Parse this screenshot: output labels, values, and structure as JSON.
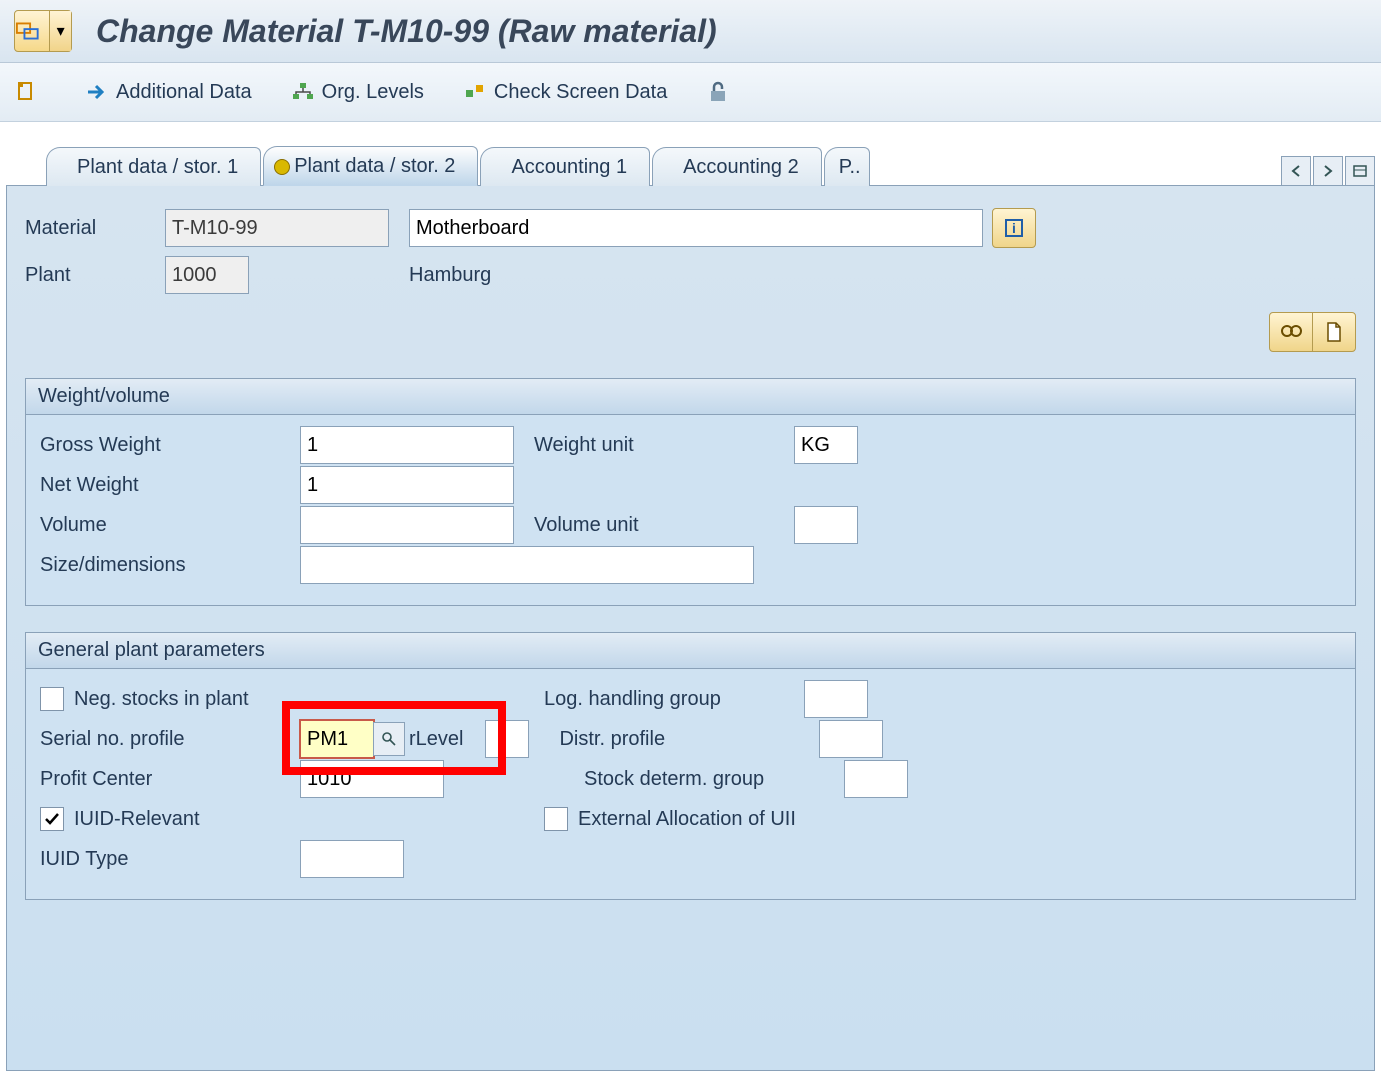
{
  "title": "Change Material T-M10-99 (Raw material)",
  "toolbar": {
    "additional_data": "Additional Data",
    "org_levels": "Org. Levels",
    "check_screen": "Check Screen Data"
  },
  "tabs": {
    "t1": "Plant data / stor. 1",
    "t2": "Plant data / stor. 2",
    "t3": "Accounting 1",
    "t4": "Accounting 2",
    "t5": "P.."
  },
  "hdr": {
    "material_label": "Material",
    "material": "T-M10-99",
    "material_desc": "Motherboard",
    "plant_label": "Plant",
    "plant": "1000",
    "plant_desc": "Hamburg"
  },
  "grp_wv": {
    "title": "Weight/volume",
    "gross_weight_lbl": "Gross Weight",
    "gross_weight": "1",
    "weight_unit_lbl": "Weight unit",
    "weight_unit": "KG",
    "net_weight_lbl": "Net Weight",
    "net_weight": "1",
    "volume_lbl": "Volume",
    "volume": "",
    "volume_unit_lbl": "Volume unit",
    "volume_unit": "",
    "size_lbl": "Size/dimensions",
    "size": ""
  },
  "grp_gp": {
    "title": "General plant parameters",
    "neg_stocks_lbl": "Neg. stocks in plant",
    "neg_stocks": false,
    "log_group_lbl": "Log. handling group",
    "log_group": "",
    "serial_profile_lbl": "Serial no. profile",
    "serial_profile": "PM1",
    "rlevel_lbl": "rLevel",
    "rlevel": "",
    "distr_profile_lbl": "Distr. profile",
    "distr_profile": "",
    "profit_center_lbl": "Profit Center",
    "profit_center": "1010",
    "stock_group_lbl": "Stock determ. group",
    "stock_group": "",
    "iuid_relevant_lbl": "IUID-Relevant",
    "iuid_relevant": true,
    "ext_alloc_lbl": "External Allocation of UII",
    "ext_alloc": false,
    "iuid_type_lbl": "IUID Type",
    "iuid_type": ""
  }
}
